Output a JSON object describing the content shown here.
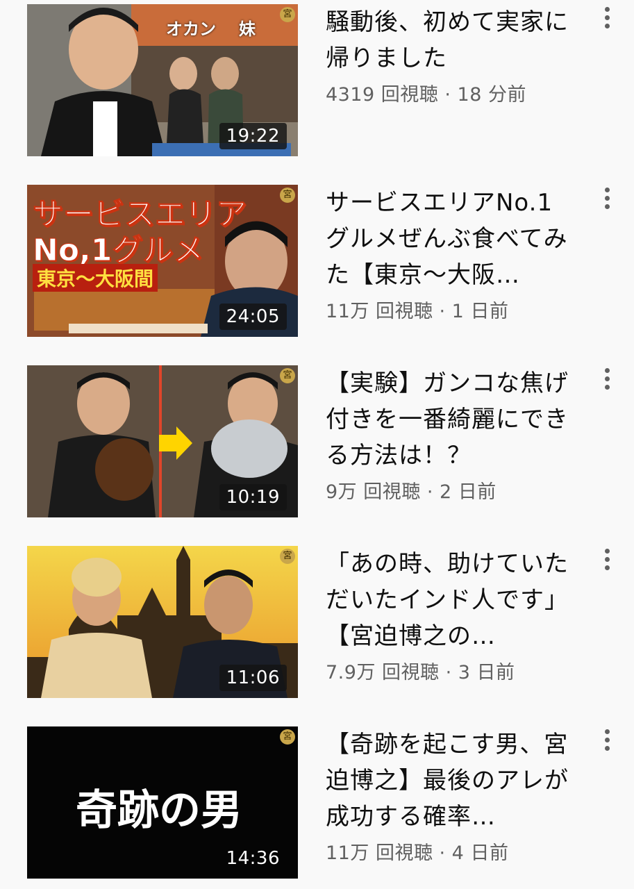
{
  "videos": [
    {
      "title": "騒動後、初めて実家に帰りました",
      "meta": "4319 回視聴 · 18 分前",
      "duration": "19:22",
      "thumb_text": [
        "オカン",
        "妹"
      ]
    },
    {
      "title": "サービスエリアNo.1グルメぜんぶ食べてみた【東京〜大阪…",
      "meta": "11万 回視聴 · 1 日前",
      "duration": "24:05",
      "thumb_text": [
        "サービスエリア",
        "No,1グルメ",
        "東京〜大阪間"
      ]
    },
    {
      "title": "【実験】ガンコな焦げ付きを一番綺麗にできる方法は！？",
      "meta": "9万 回視聴 · 2 日前",
      "duration": "10:19",
      "thumb_text": []
    },
    {
      "title": "「あの時、助けていただいたインド人です」【宮迫博之の…",
      "meta": "7.9万 回視聴 · 3 日前",
      "duration": "11:06",
      "thumb_text": []
    },
    {
      "title": "【奇跡を起こす男、宮迫博之】最後のアレが成功する確率…",
      "meta": "11万 回視聴 · 4 日前",
      "duration": "14:36",
      "thumb_text": [
        "奇跡の男"
      ]
    }
  ],
  "channel_mark": "宮",
  "colors": {
    "background": "#f9f9f9",
    "title": "#0f0f0f",
    "meta": "#606060",
    "duration_bg": "#141414"
  },
  "icons": {
    "menu": "more-vert-icon"
  }
}
